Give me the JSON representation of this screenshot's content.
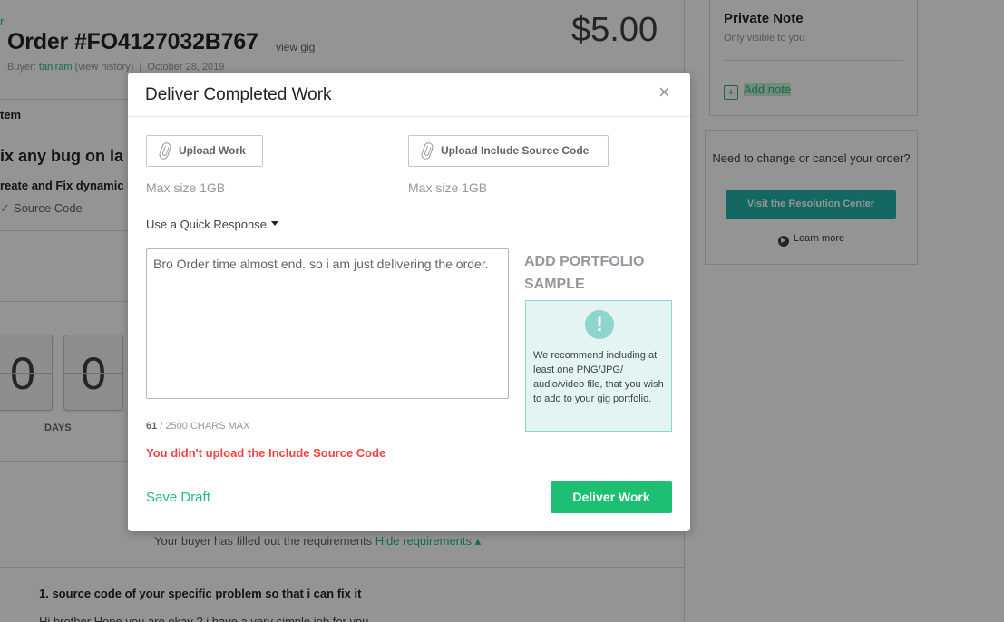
{
  "background": {
    "breadcrumb_fragment": "r",
    "order_title": "Order #FO4127032B767",
    "view_gig": "view gig",
    "buyer_label": "Buyer: ",
    "buyer_name": "taniram",
    "view_history": "(view history)",
    "order_date": "October 28, 2019",
    "price": "$5.00",
    "item_heading": "tem",
    "gig_title": "ix any bug on la",
    "gig_subtitle": "reate and Fix dynamic",
    "gig_extra": "Source Code",
    "countdown": [
      "0",
      "0"
    ],
    "days_label": "DAYS",
    "requirements_note": "Your buyer has filled out the requirements",
    "hide_requirements": "Hide requirements",
    "req_question": "1. source code of your specific problem so that i can fix it",
    "req_answer": "Hi brother Hope you are okay ? i have a very simple job for you"
  },
  "sidebar": {
    "private_note_title": "Private Note",
    "private_note_sub": "Only visible to you",
    "add_note": "Add note",
    "resolution_question": "Need to change or cancel your order?",
    "resolution_button": "Visit the Resolution Center",
    "learn_more": "Learn more"
  },
  "modal": {
    "title": "Deliver Completed Work",
    "close": "×",
    "upload_work": "Upload Work",
    "upload_source": "Upload Include Source Code",
    "max_size_1": "Max size 1GB",
    "max_size_2": "Max size 1GB",
    "quick_response": "Use a Quick Response",
    "message": "Bro Order time almost end. so i am just delivering the order.",
    "char_count": "61",
    "char_max": " / 2500 CHARS MAX",
    "error": "You didn't upload the Include Source Code",
    "portfolio_title": "ADD PORTFOLIO SAMPLE",
    "portfolio_tip": "We recommend including at least one PNG/JPG/ audio/video file, that you wish to add to your gig portfolio.",
    "save_draft": "Save Draft",
    "deliver": "Deliver Work"
  },
  "colors": {
    "accent": "#1dbf73",
    "error": "#f74040",
    "teal": "#21b5aa"
  }
}
